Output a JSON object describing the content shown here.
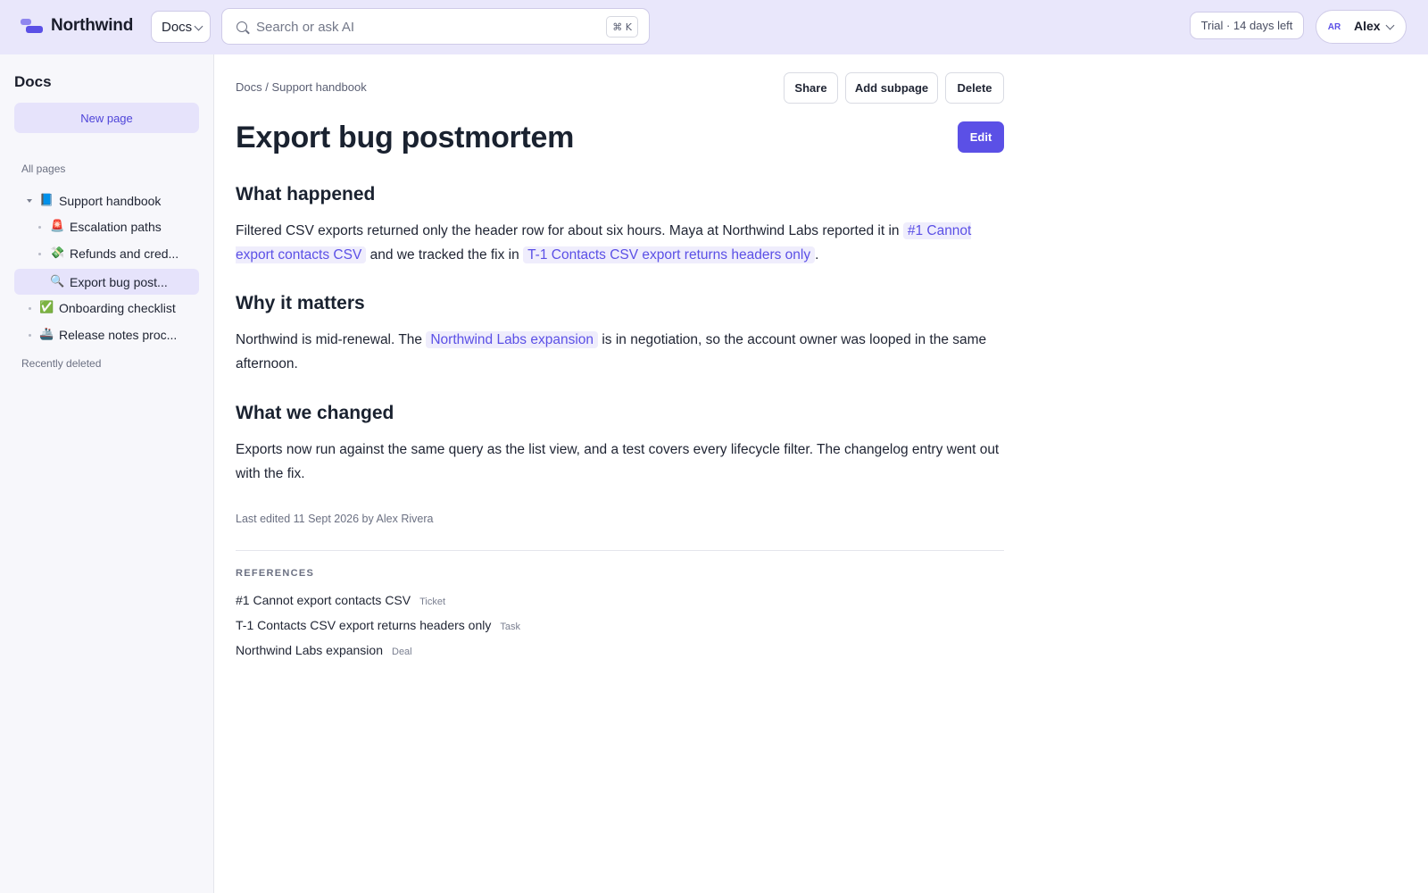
{
  "topbar": {
    "brand": "Northwind",
    "section_select": "Docs",
    "search_placeholder": "Search or ask AI",
    "search_shortcut": "⌘ K",
    "trial_badge": "Trial · 14 days left",
    "user_initials": "AR",
    "user_name": "Alex"
  },
  "sidebar": {
    "title": "Docs",
    "new_page_label": "New page",
    "all_pages_label": "All pages",
    "recently_deleted_label": "Recently deleted",
    "items": [
      {
        "emoji": "📘",
        "label": "Support handbook"
      },
      {
        "emoji": "🚨",
        "label": "Escalation paths"
      },
      {
        "emoji": "💸",
        "label": "Refunds and cred..."
      },
      {
        "emoji": "🔍",
        "label": "Export bug post..."
      },
      {
        "emoji": "✅",
        "label": "Onboarding checklist"
      },
      {
        "emoji": "🚢",
        "label": "Release notes proc..."
      }
    ]
  },
  "page": {
    "breadcrumb": "Docs / Support handbook",
    "actions": {
      "share": "Share",
      "add_subpage": "Add subpage",
      "delete": "Delete",
      "edit": "Edit"
    },
    "title": "Export bug postmortem",
    "sections": [
      {
        "heading": "What happened",
        "p1": "Filtered CSV exports returned only the header row for about six hours. Maya at Northwind Labs reported it in ",
        "link1": "#1 Cannot export contacts CSV",
        "p2": " and we tracked the fix in ",
        "link2": "T-1 Contacts CSV export returns headers only",
        "p3": "."
      },
      {
        "heading": "Why it matters",
        "p1": "Northwind is mid-renewal. The ",
        "link1": "Northwind Labs expansion",
        "p2": " is in negotiation, so the account owner was looped in the same afternoon."
      },
      {
        "heading": "What we changed",
        "p1": "Exports now run against the same query as the list view, and a test covers every lifecycle filter. The changelog entry went out with the fix."
      }
    ],
    "last_edited": "Last edited 11 Sept 2026 by Alex Rivera",
    "references_label": "REFERENCES",
    "references": [
      {
        "title": "#1 Cannot export contacts CSV",
        "type": "Ticket"
      },
      {
        "title": "T-1 Contacts CSV export returns headers only",
        "type": "Task"
      },
      {
        "title": "Northwind Labs expansion",
        "type": "Deal"
      }
    ]
  },
  "colors": {
    "accent": "#5b50e6",
    "topbar_bg": "#e9e7fb",
    "sidebar_bg": "#f7f7fb",
    "chip_bg": "#efedfc"
  }
}
